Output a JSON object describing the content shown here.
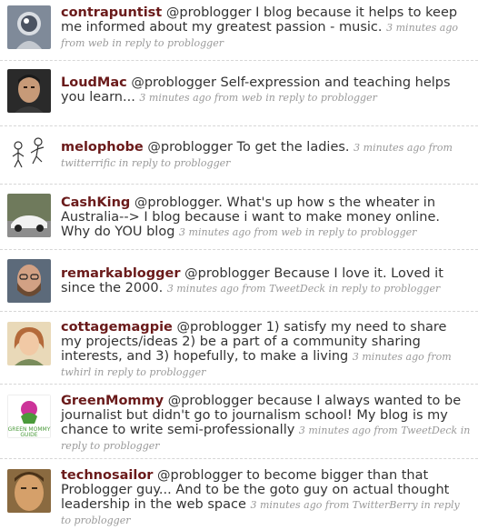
{
  "colors": {
    "username": "#6a1a1a",
    "text": "#333333",
    "meta": "#999999",
    "divider": "#d6d6d6"
  },
  "tweets": [
    {
      "username": "contrapuntist",
      "avatar_icon": "silver-robot-avatar",
      "text": "@problogger I blog because it helps to keep me informed about my greatest passion - music.",
      "time": "3 minutes ago",
      "source_label": "from web",
      "reply_label": "in reply to problogger"
    },
    {
      "username": "LoudMac",
      "avatar_icon": "man-portrait-avatar",
      "text": "@problogger Self-expression and teaching helps you learn...",
      "time": "3 minutes ago",
      "source_label": "from web",
      "reply_label": "in reply to problogger"
    },
    {
      "username": "melophobe",
      "avatar_icon": "stick-figure-sketch-avatar",
      "text": "@problogger To get the ladies.",
      "time": "3 minutes ago",
      "source_label": "from twitterrific",
      "reply_label": "in reply to problogger"
    },
    {
      "username": "CashKing",
      "avatar_icon": "sports-car-avatar",
      "text": "@problogger. What's up how s the wheater in Australia--> I blog because i want to make money online. Why do YOU blog",
      "time": "3 minutes ago",
      "source_label": "from web",
      "reply_label": "in reply to problogger"
    },
    {
      "username": "remarkablogger",
      "avatar_icon": "bearded-man-avatar",
      "text": "@problogger Because I love it. Loved it since the 2000.",
      "time": "3 minutes ago",
      "source_label": "from TweetDeck",
      "reply_label": "in reply to problogger"
    },
    {
      "username": "cottagemagpie",
      "avatar_icon": "woman-portrait-avatar",
      "text": "@problogger 1) satisfy my need to share my projects/ideas 2) be a part of a community sharing interests, and 3) hopefully, to make a living",
      "time": "3 minutes ago",
      "source_label": "from twhirl",
      "reply_label": "in reply to problogger"
    },
    {
      "username": "GreenMommy",
      "avatar_icon": "green-mommy-guide-logo",
      "logo_text": "GREEN MOMMY GUIDE",
      "text": "@problogger because I always wanted to be journalist but didn't go to journalism school! My blog is my chance to write semi-professionally",
      "time": "3 minutes ago",
      "source_label": "from TweetDeck",
      "reply_label": "in reply to problogger"
    },
    {
      "username": "technosailor",
      "avatar_icon": "man-closeup-avatar",
      "text": "@problogger to become bigger than that Problogger guy... And to be the goto guy on actual thought leadership in the web space",
      "time": "3 minutes ago",
      "source_label": "from TwitterBerry",
      "reply_label": "in reply to problogger"
    }
  ]
}
